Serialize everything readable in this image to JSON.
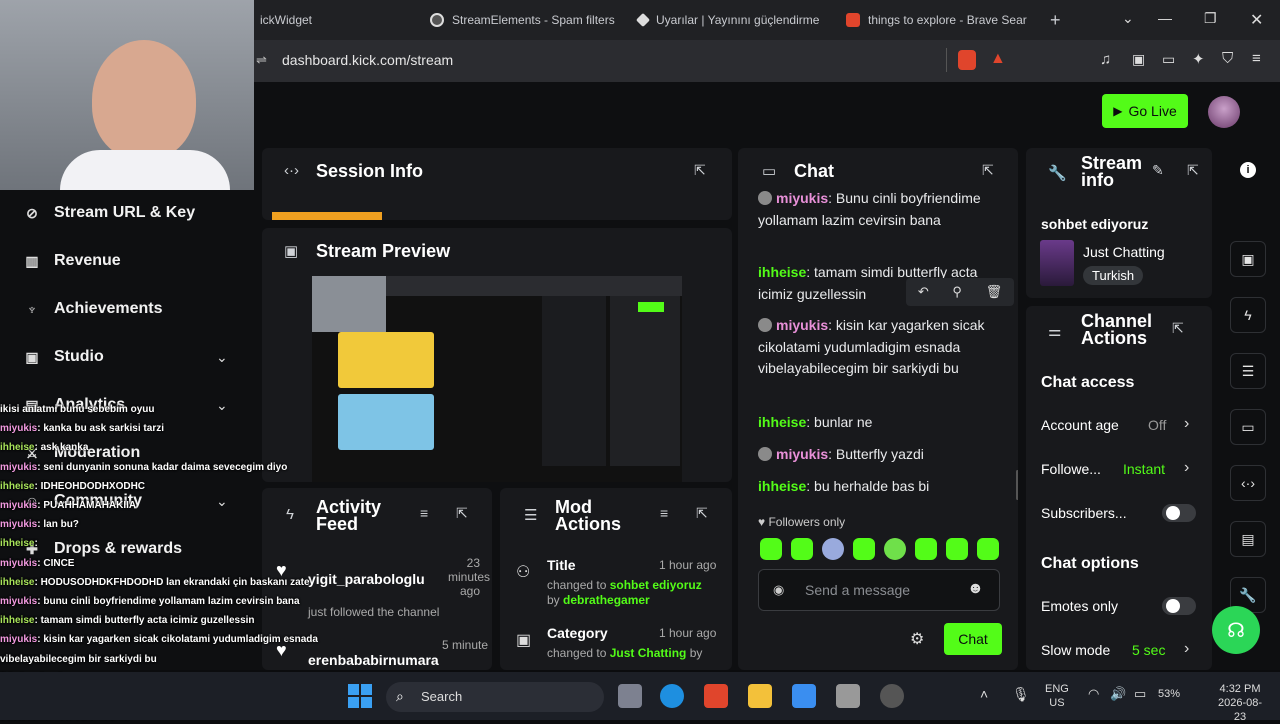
{
  "browser": {
    "tabs": [
      {
        "title": "ickWidget"
      },
      {
        "title": "StreamElements - Spam filters"
      },
      {
        "title": "Uyarılar | Yayınını güçlendirme"
      },
      {
        "title": "things to explore - Brave Sear"
      }
    ],
    "new_tab": "+",
    "url": "dashboard.kick.com/stream"
  },
  "header": {
    "go_live": "Go Live"
  },
  "sidebar": {
    "items": [
      {
        "label": "Stream URL & Key"
      },
      {
        "label": "Revenue"
      },
      {
        "label": "Achievements"
      },
      {
        "label": "Studio"
      },
      {
        "label": "Analytics"
      },
      {
        "label": "Moderation"
      },
      {
        "label": "Community"
      },
      {
        "label": "Drops & rewards"
      }
    ]
  },
  "session": {
    "title": "Session Info"
  },
  "preview": {
    "title": "Stream Preview"
  },
  "activity": {
    "title_line1": "Activity",
    "title_line2": "Feed",
    "items": [
      {
        "user": "yigit_parabologlu",
        "time": "23 minutes ago",
        "desc": "just followed the channel"
      },
      {
        "user": "erenbababirnumara",
        "time": "5 minute",
        "desc": ""
      }
    ]
  },
  "mod": {
    "title_line1": "Mod",
    "title_line2": "Actions",
    "items": [
      {
        "label": "Title",
        "time": "1 hour ago",
        "changed": "changed to ",
        "value": "sohbet ediyoruz",
        "by": "by ",
        "user": "debrathegamer"
      },
      {
        "label": "Category",
        "time": "1 hour ago",
        "changed": "changed to ",
        "value": "Just Chatting",
        "by": "by",
        "user": ""
      }
    ]
  },
  "chat": {
    "title": "Chat",
    "messages": [
      {
        "user": "miyukis",
        "text": ": Bunu cinli boyfriendime yollamam lazim cevirsin bana"
      },
      {
        "user": "ihheise",
        "text": ": tamam simdi butterfly acta icimiz guzellessin"
      },
      {
        "user": "miyukis",
        "text": ": kisin kar yagarken sicak cikolatami yudumladigim esnada vibelayabilecegim bir sarkiydi bu"
      },
      {
        "user": "ihheise",
        "text": ": bunlar ne"
      },
      {
        "user": "miyukis",
        "text": ": Butterfly yazdi"
      },
      {
        "user": "ihheise",
        "text": ": bu herhalde bas bi"
      }
    ],
    "followers_only": "Followers only",
    "placeholder": "Send a message",
    "send": "Chat"
  },
  "stream_info": {
    "title_line1": "Stream",
    "title_line2": "info",
    "stream_title": "sohbet ediyoruz",
    "category": "Just Chatting",
    "language": "Turkish"
  },
  "channel_actions": {
    "title_line1": "Channel",
    "title_line2": "Actions",
    "chat_access": "Chat access",
    "account_age": "Account age",
    "account_age_value": "Off",
    "followers": "Followe...",
    "followers_value": "Instant",
    "subscribers": "Subscribers...",
    "chat_options": "Chat options",
    "emotes_only": "Emotes only",
    "slow_mode": "Slow mode",
    "slow_mode_value": "5 sec"
  },
  "overlay_chat": [
    {
      "name": "",
      "text": "ikisi anlatmi bunu sebebim oyuu"
    },
    {
      "name": "miyukis",
      "text": ": kanka bu ask sarkisi tarzi"
    },
    {
      "name": "ihheise",
      "text": ": ask kanka"
    },
    {
      "name": "miyukis",
      "text": ": seni dunyanin sonuna kadar daima sevecegim diyo"
    },
    {
      "name": "ihheise",
      "text": ": IDHEOHDODHXODHC"
    },
    {
      "name": "miyukis",
      "text": ": PUAHHAMAHAKIIA"
    },
    {
      "name": "miyukis",
      "text": ": lan bu?"
    },
    {
      "name": "ihheise",
      "text": ": "
    },
    {
      "name": "miyukis",
      "text": ": CINCE"
    },
    {
      "name": "ihheise",
      "text": ": HODUSODHDKFHDODHD lan ekrandaki çin baskanı zate"
    },
    {
      "name": "miyukis",
      "text": ": bunu cinli boyfriendime yollamam lazim cevirsin bana"
    },
    {
      "name": "ihheise",
      "text": ": tamam simdi butterfly acta icimiz guzellessin"
    },
    {
      "name": "miyukis",
      "text": ": kisin kar yagarken sicak cikolatami yudumladigim esnada"
    },
    {
      "name": "",
      "text": "vibelayabilecegim bir sarkiydi bu"
    },
    {
      "name": "ihheise",
      "text": ": bunlar ne"
    },
    {
      "name": "miyukis",
      "text": ": Butterfly yazdi"
    },
    {
      "name": "ihheise",
      "text": ": bu herhalde bas bi"
    }
  ],
  "taskbar": {
    "search": "Search",
    "lang1": "ENG",
    "lang2": "US",
    "battery": "53%",
    "time": "4:32 PM",
    "date": "2026-08-23"
  },
  "colors": {
    "accent": "#53fc18",
    "panel": "#18191c",
    "bg": "#0e0f11"
  }
}
